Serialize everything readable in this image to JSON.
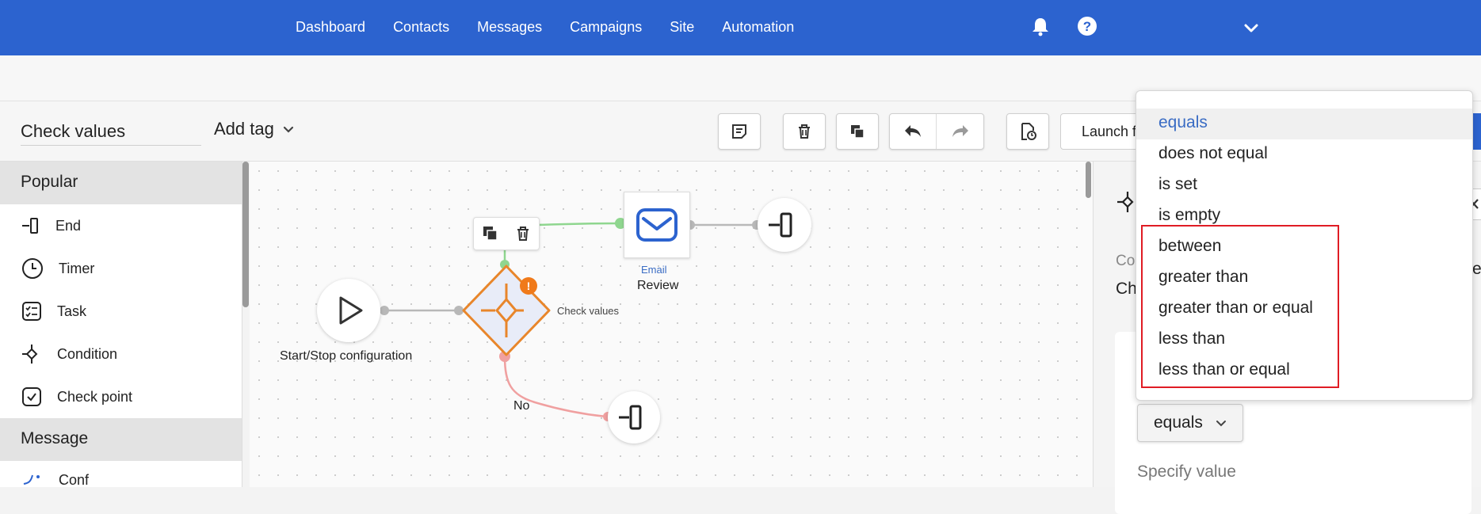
{
  "nav": {
    "items": [
      "Dashboard",
      "Contacts",
      "Messages",
      "Campaigns",
      "Site",
      "Automation"
    ]
  },
  "header_icons": [
    "bell-icon",
    "help-icon",
    "chevron-down-icon"
  ],
  "toolbar": {
    "workflow_name": "Check values",
    "add_tag_label": "Add tag",
    "launch_label": "Launch f"
  },
  "sidebar": {
    "sections": [
      {
        "title": "Popular",
        "items": [
          {
            "label": "End",
            "icon": "end-icon"
          },
          {
            "label": "Timer",
            "icon": "timer-icon"
          },
          {
            "label": "Task",
            "icon": "task-icon"
          },
          {
            "label": "Condition",
            "icon": "condition-icon"
          },
          {
            "label": "Check point",
            "icon": "checkpoint-icon"
          }
        ]
      },
      {
        "title": "Message",
        "items": [
          {
            "label": "Conf",
            "icon": "sparkle-icon"
          }
        ]
      }
    ]
  },
  "canvas": {
    "start_label": "Start/Stop configuration",
    "condition_label": "Check values",
    "email_type": "Email",
    "email_name": "Review",
    "no_label": "No",
    "warning_mark": "!"
  },
  "right_panel": {
    "partial_label_1": "Co",
    "partial_label_2": "Ch",
    "partial_label_3": "e",
    "operator_value": "equals",
    "specify_value_label": "Specify value"
  },
  "dropdown": {
    "options": [
      "equals",
      "does not equal",
      "is set",
      "is empty",
      "between",
      "greater than",
      "greater than or equal",
      "less than",
      "less than or equal"
    ],
    "selected": "equals"
  },
  "colors": {
    "brand_blue": "#2c63cf",
    "condition_orange": "#e8862b",
    "connector_green": "#8fd68f",
    "connector_red": "#f0a0a0",
    "highlight_red": "#e01c24",
    "link_blue": "#3a6cc4"
  }
}
